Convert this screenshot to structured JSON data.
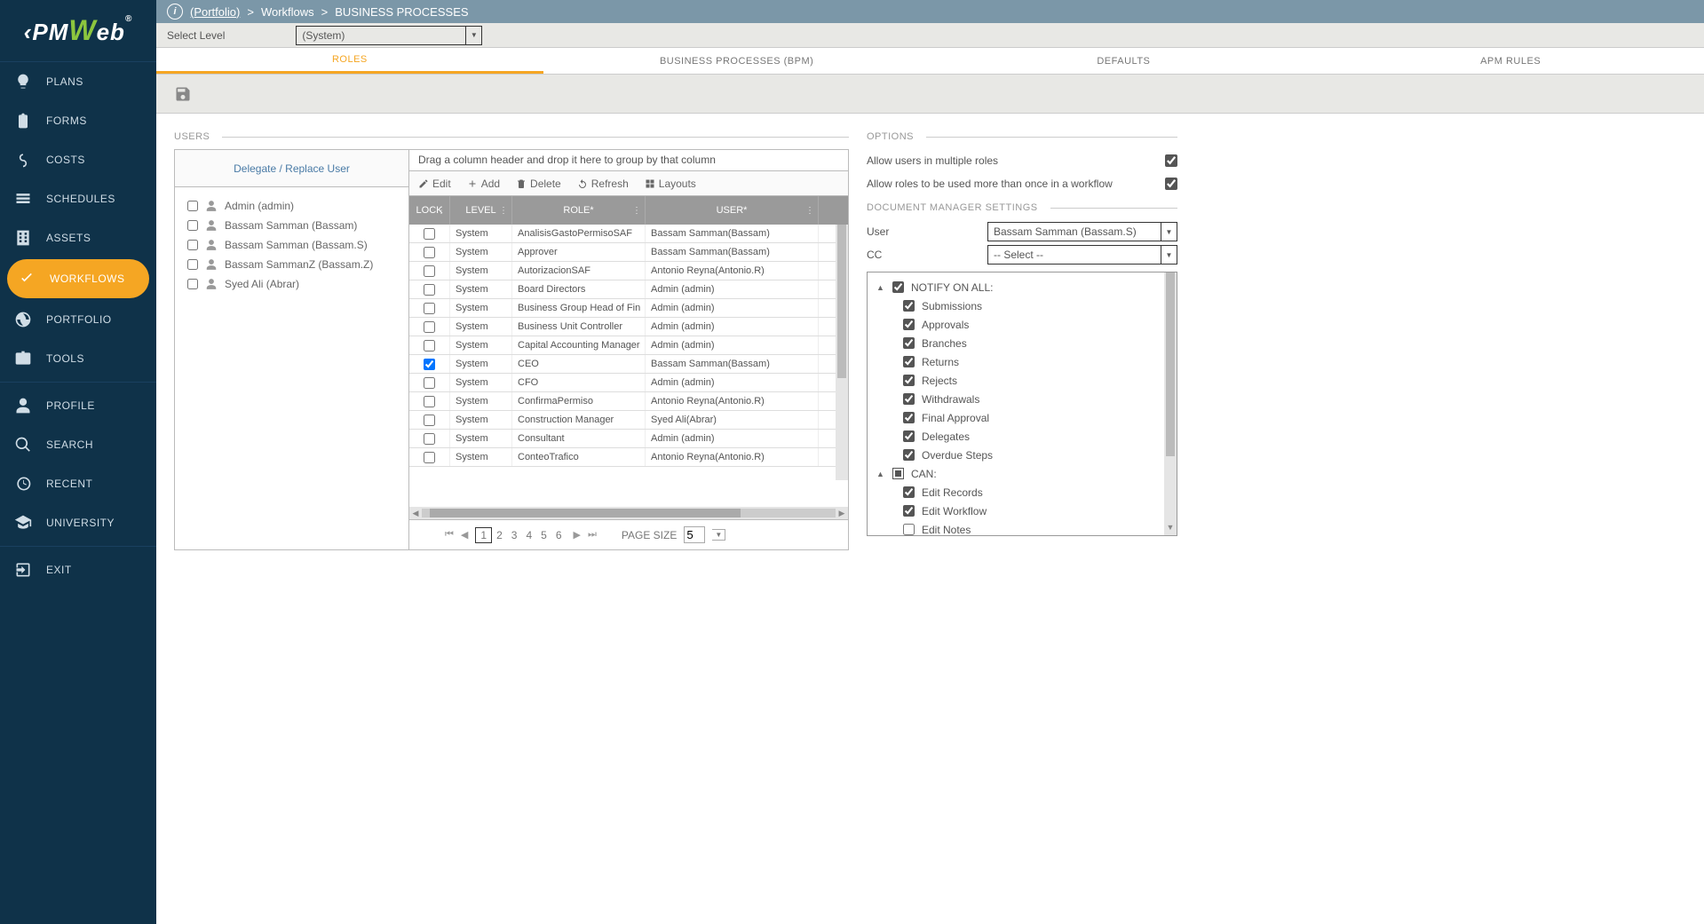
{
  "breadcrumb": {
    "portfolio": "(Portfolio)",
    "sep": ">",
    "workflows": "Workflows",
    "page": "BUSINESS PROCESSES"
  },
  "level_bar": {
    "label": "Select Level",
    "value": "(System)"
  },
  "tabs": [
    "ROLES",
    "BUSINESS PROCESSES (BPM)",
    "DEFAULTS",
    "APM RULES"
  ],
  "sidebar": {
    "items": [
      {
        "label": "PLANS",
        "icon": "bulb"
      },
      {
        "label": "FORMS",
        "icon": "clipboard"
      },
      {
        "label": "COSTS",
        "icon": "dollar"
      },
      {
        "label": "SCHEDULES",
        "icon": "bars"
      },
      {
        "label": "ASSETS",
        "icon": "building"
      },
      {
        "label": "WORKFLOWS",
        "icon": "check",
        "active": true
      },
      {
        "label": "PORTFOLIO",
        "icon": "globe"
      },
      {
        "label": "TOOLS",
        "icon": "briefcase"
      }
    ],
    "items2": [
      {
        "label": "PROFILE",
        "icon": "person"
      },
      {
        "label": "SEARCH",
        "icon": "search"
      },
      {
        "label": "RECENT",
        "icon": "history"
      },
      {
        "label": "UNIVERSITY",
        "icon": "grad"
      }
    ],
    "exit": {
      "label": "EXIT",
      "icon": "exit"
    }
  },
  "users_panel": {
    "title": "USERS",
    "delegate_header": "Delegate / Replace User",
    "users": [
      "Admin (admin)",
      "Bassam Samman (Bassam)",
      "Bassam Samman (Bassam.S)",
      "Bassam SammanZ (Bassam.Z)",
      "Syed Ali (Abrar)"
    ],
    "drag_hint": "Drag a column header and drop it here to group by that column",
    "grid_toolbar": [
      "Edit",
      "Add",
      "Delete",
      "Refresh",
      "Layouts"
    ],
    "columns": [
      "LOCK",
      "LEVEL",
      "ROLE*",
      "USER*"
    ],
    "rows": [
      {
        "lock": false,
        "level": "System",
        "role": "AnalisisGastoPermisoSAF",
        "user": "Bassam Samman(Bassam)"
      },
      {
        "lock": false,
        "level": "System",
        "role": "Approver",
        "user": "Bassam Samman(Bassam)"
      },
      {
        "lock": false,
        "level": "System",
        "role": "AutorizacionSAF",
        "user": "Antonio Reyna(Antonio.R)"
      },
      {
        "lock": false,
        "level": "System",
        "role": "Board Directors",
        "user": "Admin (admin)"
      },
      {
        "lock": false,
        "level": "System",
        "role": "Business Group Head of Fin",
        "user": "Admin (admin)"
      },
      {
        "lock": false,
        "level": "System",
        "role": "Business Unit Controller",
        "user": "Admin (admin)"
      },
      {
        "lock": false,
        "level": "System",
        "role": "Capital Accounting Manager",
        "user": "Admin (admin)"
      },
      {
        "lock": true,
        "level": "System",
        "role": "CEO",
        "user": "Bassam Samman(Bassam)"
      },
      {
        "lock": false,
        "level": "System",
        "role": "CFO",
        "user": "Admin (admin)"
      },
      {
        "lock": false,
        "level": "System",
        "role": "ConfirmaPermiso",
        "user": "Antonio Reyna(Antonio.R)"
      },
      {
        "lock": false,
        "level": "System",
        "role": "Construction Manager",
        "user": "Syed Ali(Abrar)"
      },
      {
        "lock": false,
        "level": "System",
        "role": "Consultant",
        "user": "Admin (admin)"
      },
      {
        "lock": false,
        "level": "System",
        "role": "ConteoTrafico",
        "user": "Antonio Reyna(Antonio.R)"
      }
    ],
    "pager": {
      "pages": [
        "1",
        "2",
        "3",
        "4",
        "5",
        "6"
      ],
      "page_size_label": "PAGE SIZE",
      "page_size": "5"
    }
  },
  "options_panel": {
    "title": "OPTIONS",
    "opt1": "Allow users in multiple roles",
    "opt2": "Allow roles to be used more than once in a workflow",
    "doc_mgr": "DOCUMENT MANAGER SETTINGS",
    "user_label": "User",
    "user_value": "Bassam Samman (Bassam.S)",
    "cc_label": "CC",
    "cc_value": "-- Select --",
    "notify_group": "NOTIFY ON ALL:",
    "notify_items": [
      {
        "label": "Submissions",
        "checked": true
      },
      {
        "label": "Approvals",
        "checked": true
      },
      {
        "label": "Branches",
        "checked": true
      },
      {
        "label": "Returns",
        "checked": true
      },
      {
        "label": "Rejects",
        "checked": true
      },
      {
        "label": "Withdrawals",
        "checked": true
      },
      {
        "label": "Final Approval",
        "checked": true
      },
      {
        "label": "Delegates",
        "checked": true
      },
      {
        "label": "Overdue Steps",
        "checked": true
      }
    ],
    "can_group": "CAN:",
    "can_items": [
      {
        "label": "Edit Records",
        "checked": true
      },
      {
        "label": "Edit Workflow",
        "checked": true
      },
      {
        "label": "Edit Notes",
        "checked": false
      }
    ]
  }
}
